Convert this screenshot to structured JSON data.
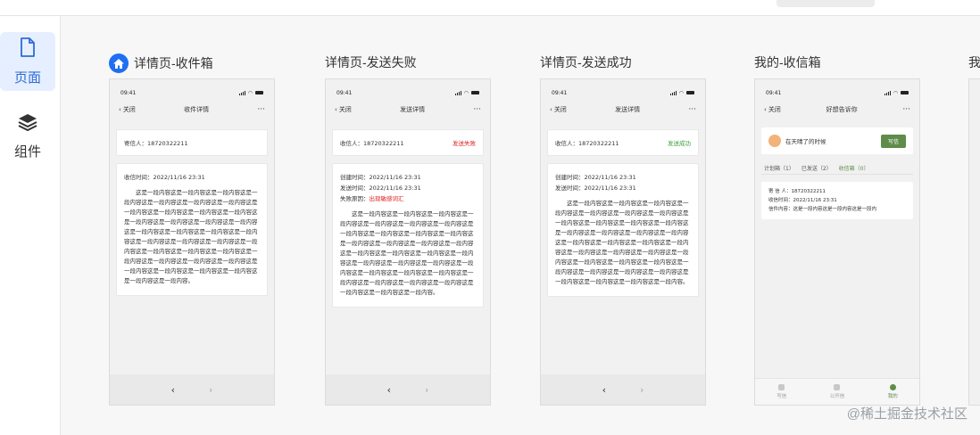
{
  "sidebar": {
    "items": [
      {
        "label": "页面",
        "icon": "page-icon"
      },
      {
        "label": "组件",
        "icon": "layers-icon"
      }
    ]
  },
  "frames": [
    {
      "title": "详情页-收件箱",
      "nav_title": "收件详情",
      "back_label": "关闭",
      "time": "09:41",
      "row_label": "寄信人：18720322211",
      "meta_lines": [
        "收信时间：2022/11/16 23:31"
      ],
      "body": "这是一段内容这是一段内容这是一段内容这是一段内容这是一段内容这是一段内容这是一段内容这是一段内容这是一段内容这是一段内容这是一段内容这是一段内容这是一段内容这是一段内容这是一段内容这是一段内容这是一段内容这是一段内容这是一段内容这是一段内容这是一段内容这是一段内容这是一段内容这是一段内容这是一段内容这是一段内容这是一段内容这是一段内容这是一段内容这是一段内容这是一段内容这是一段内容这是一段内容这是一段内容这是一段内容这是一段内容。"
    },
    {
      "title": "详情页-发送失败",
      "nav_title": "发送详情",
      "back_label": "关闭",
      "time": "09:41",
      "row_label": "收信人：18720322211",
      "status": "发送失败",
      "meta_lines": [
        "创建时间：2022/11/16 23:31",
        "发送时间：2022/11/16 23:31"
      ],
      "reason_label": "失败原因：",
      "reason_value": "出现敏感词汇",
      "body": "这是一段内容这是一段内容这是一段内容这是一段内容这是一段内容这是一段内容这是一段内容这是一段内容这是一段内容这是一段内容这是一段内容这是一段内容这是一段内容这是一段内容这是一段内容这是一段内容这是一段内容这是一段内容这是一段内容这是一段内容这是一段内容这是一段内容这是一段内容这是一段内容这是一段内容这是一段内容这是一段内容这是一段内容这是一段内容这是一段内容这是一段内容这是一段内容这是一段内容。"
    },
    {
      "title": "详情页-发送成功",
      "nav_title": "发送详情",
      "back_label": "关闭",
      "time": "09:41",
      "row_label": "收信人：18720322211",
      "status": "发送成功",
      "meta_lines": [
        "创建时间：2022/11/16 23:31",
        "发送时间：2022/11/16 23:31"
      ],
      "body": "这是一段内容这是一段内容这是一段内容这是一段内容这是一段内容这是一段内容这是一段内容这是一段内容这是一段内容这是一段内容这是一段内容这是一段内容这是一段内容这是一段内容这是一段内容这是一段内容这是一段内容这是一段内容这是一段内容这是一段内容这是一段内容这是一段内容这是一段内容这是一段内容这是一段内容这是一段内容这是一段内容这是一段内容这是一段内容这是一段内容这是一段内容这是一段内容这是一段内容这是一段内容。"
    },
    {
      "title": "我的-收信箱",
      "nav_title": "好想告诉你",
      "back_label": "关闭",
      "time": "09:41",
      "notice_text": "在天晴了的时候",
      "send_label": "写信",
      "tabs": [
        "计划箱（1）",
        "已发送（2）",
        "收信箱（0）"
      ],
      "msg_lines": [
        "寄 信 人：18720322211",
        "收信时间：2022/11/16 23:31",
        "信件内容：这是一段内容这是一段内容这是一段内"
      ],
      "tabbar": [
        "写信",
        "公开信",
        "我的"
      ]
    }
  ],
  "partial_title": "我",
  "watermark": "@稀土掘金技术社区",
  "colors": {
    "accent": "#2e6bd6",
    "fail": "#e02020",
    "success": "#3a9b3a",
    "green": "#5f8c4a"
  }
}
